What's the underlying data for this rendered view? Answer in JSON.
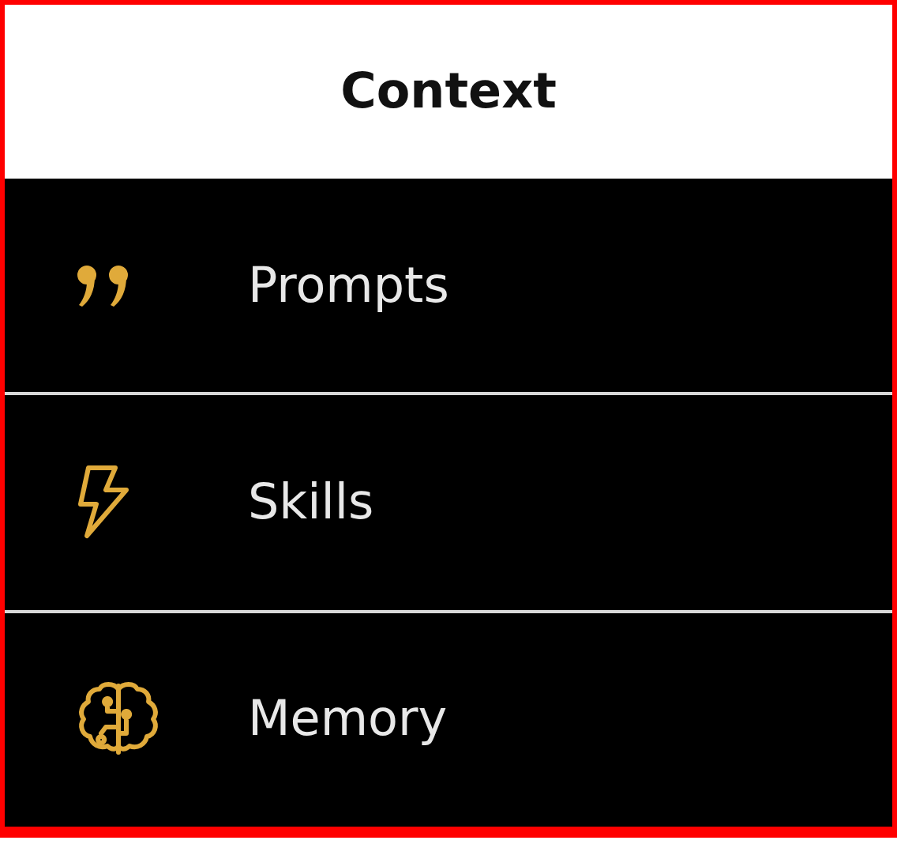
{
  "header": {
    "title": "Context"
  },
  "items": [
    {
      "label": "Prompts",
      "kind": "quote"
    },
    {
      "label": "Skills",
      "kind": "bolt"
    },
    {
      "label": "Memory",
      "kind": "brain"
    }
  ]
}
